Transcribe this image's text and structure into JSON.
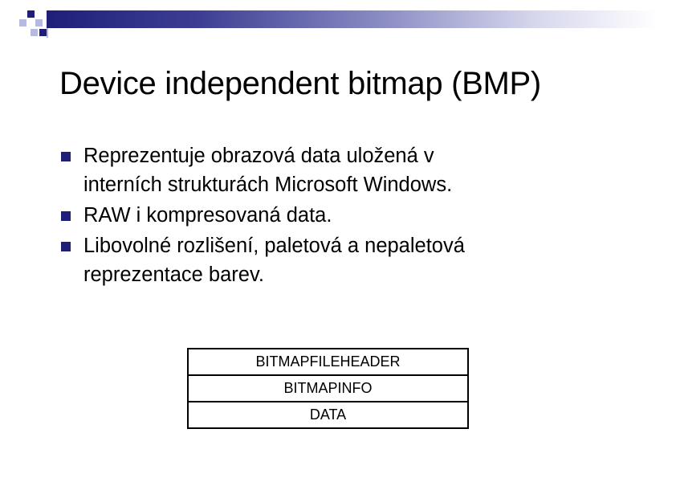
{
  "header": {
    "title": "Device independent bitmap (BMP)"
  },
  "bullets": [
    {
      "text_line1": "Reprezentuje obrazová data uložená v",
      "text_line2": "interních strukturách Microsoft Windows."
    },
    {
      "text_line1": "RAW i kompresovaná data.",
      "text_line2": ""
    },
    {
      "text_line1": "Libovolné rozlišení, paletová a nepaletová",
      "text_line2": "reprezentace barev."
    }
  ],
  "structure": {
    "rows": [
      "BITMAPFILEHEADER",
      "BITMAPINFO",
      "DATA"
    ]
  },
  "colors": {
    "accent": "#1f1f7a",
    "accent_light": "#b7b9de"
  },
  "icons": {
    "bullet": "square-bullet-icon"
  }
}
